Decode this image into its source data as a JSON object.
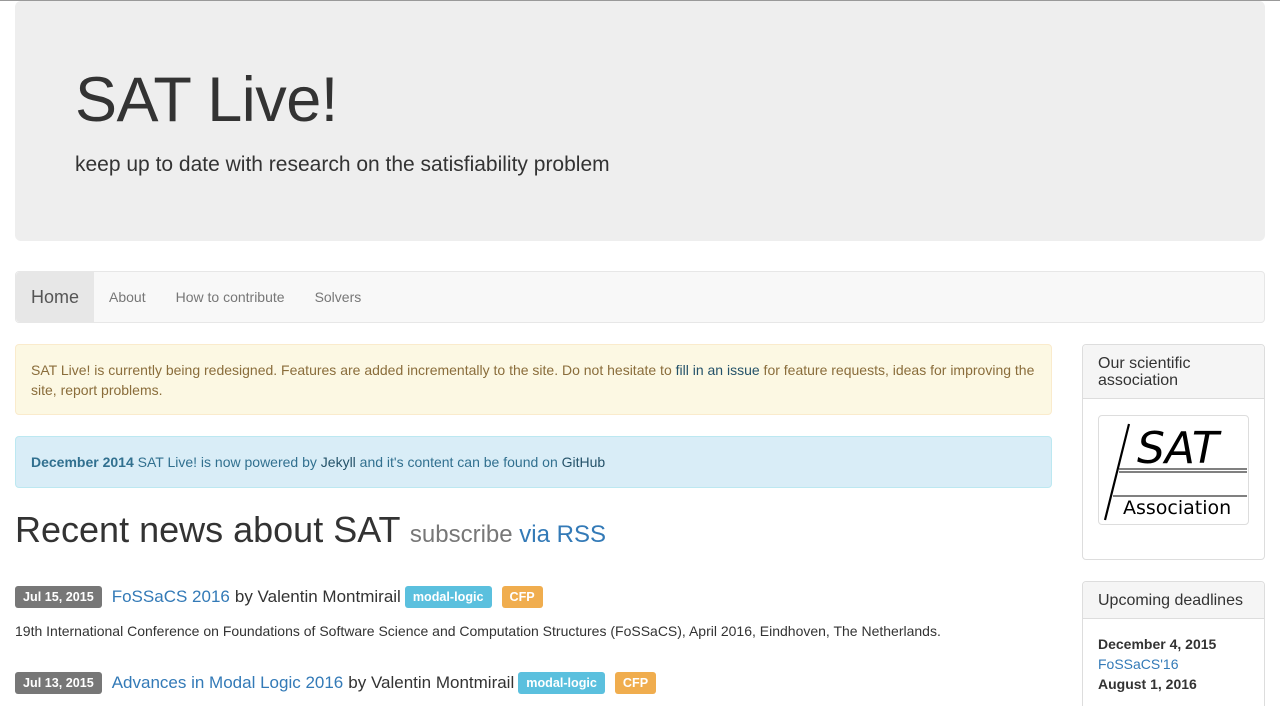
{
  "header": {
    "title": "SAT Live!",
    "subtitle": "keep up to date with research on the satisfiability problem"
  },
  "nav": {
    "items": [
      {
        "label": "Home",
        "active": true
      },
      {
        "label": "About"
      },
      {
        "label": "How to contribute"
      },
      {
        "label": "Solvers"
      }
    ]
  },
  "alerts": {
    "warning": {
      "text_before": "SAT Live! is currently being redesigned. Features are added incrementally to the site. Do not hesitate to ",
      "link": "fill in an issue",
      "text_after": " for feature requests, ideas for improving the site, report problems."
    },
    "info": {
      "date": "December 2014",
      "text1": " SAT Live! is now powered by ",
      "link1": "Jekyll",
      "text2": " and it's content can be found on ",
      "link2": "GitHub"
    }
  },
  "news": {
    "heading": "Recent news about SAT",
    "subscribe": "subscribe",
    "rss_link": "via RSS",
    "posts": [
      {
        "date": "Jul 15, 2015",
        "title": "FoSSaCS 2016",
        "by": "by Valentin Montmirail",
        "tag": "modal-logic",
        "cfp": "CFP",
        "description": "19th International Conference on Foundations of Software Science and Computation Structures (FoSSaCS), April 2016, Eindhoven, The Netherlands."
      },
      {
        "date": "Jul 13, 2015",
        "title": "Advances in Modal Logic 2016",
        "by": "by Valentin Montmirail",
        "tag": "modal-logic",
        "cfp": "CFP"
      }
    ]
  },
  "sidebar": {
    "association": {
      "heading": "Our scientific association",
      "logo_text_big": "SAT",
      "logo_text_small": "Association"
    },
    "deadlines": {
      "heading": "Upcoming deadlines",
      "items": [
        {
          "date": "December 4, 2015",
          "event": "FoSSaCS'16"
        },
        {
          "date": "August 1, 2016",
          "event": ""
        }
      ]
    }
  },
  "colors": {
    "link": "#337ab7",
    "label_date": "#777777",
    "label_tag": "#5bc0de",
    "label_cfp": "#f0ad4e"
  }
}
